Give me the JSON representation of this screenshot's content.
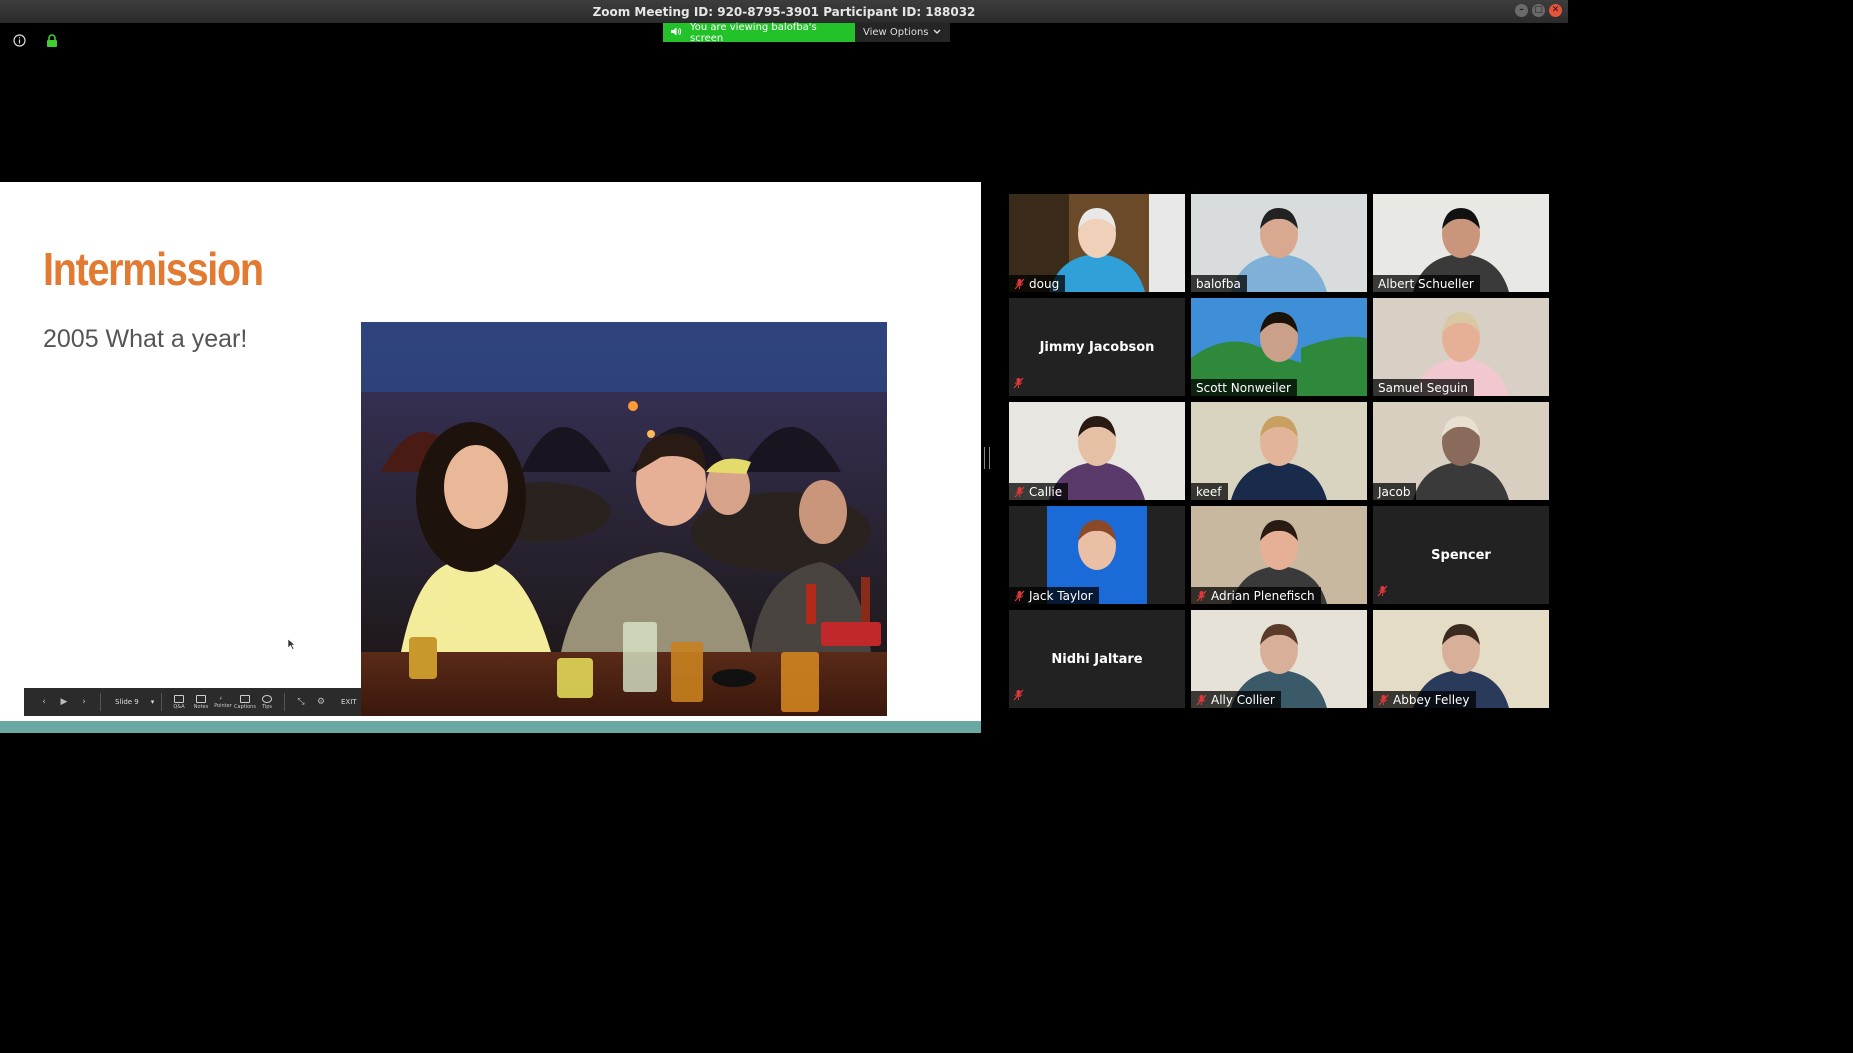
{
  "window": {
    "title": "Zoom Meeting ID: 920-8795-3901 Participant ID: 188032",
    "controls": [
      "minimize",
      "maximize",
      "close"
    ]
  },
  "top_icons": [
    "info-icon",
    "lock-icon"
  ],
  "banner": {
    "viewing_text": "You are viewing balofba's screen",
    "view_options_label": "View Options"
  },
  "slide": {
    "title": "Intermission",
    "subtitle": "2005 What a year!",
    "toolbar": {
      "prev": "‹",
      "play": "▶",
      "next": "›",
      "slide_label": "Slide 9",
      "buttons": [
        "Q&A",
        "Notes",
        "Pointer",
        "Captions",
        "Tips"
      ],
      "exit": "EXIT"
    }
  },
  "colors": {
    "title_orange": "#e37a32",
    "banner_green": "#23c12a",
    "slide_accent_bar": "#6aa9a3",
    "mute_red": "#e0383a"
  },
  "participants": [
    {
      "name": "doug",
      "muted": true,
      "video": true
    },
    {
      "name": "balofba",
      "muted": false,
      "video": true
    },
    {
      "name": "Albert Schueller",
      "muted": false,
      "video": true
    },
    {
      "name": "Jimmy Jacobson",
      "muted": true,
      "video": false
    },
    {
      "name": "Scott Nonweiler",
      "muted": false,
      "video": true
    },
    {
      "name": "Samuel Seguin",
      "muted": false,
      "video": true
    },
    {
      "name": "Callie",
      "muted": true,
      "video": true
    },
    {
      "name": "keef",
      "muted": false,
      "video": true
    },
    {
      "name": "Jacob",
      "muted": false,
      "video": true
    },
    {
      "name": "Jack Taylor",
      "muted": true,
      "video": true
    },
    {
      "name": "Adrian Plenefisch",
      "muted": true,
      "video": true
    },
    {
      "name": "Spencer",
      "muted": true,
      "video": false
    },
    {
      "name": "Nidhi Jaltare",
      "muted": true,
      "video": false
    },
    {
      "name": "Ally Collier",
      "muted": true,
      "video": true
    },
    {
      "name": "Abbey Felley",
      "muted": true,
      "video": true
    }
  ]
}
